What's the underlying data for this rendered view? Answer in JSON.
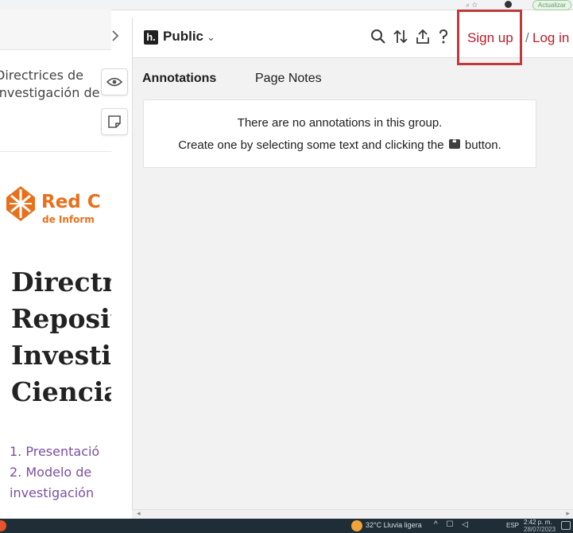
{
  "browser": {
    "update_label": "Actualizar"
  },
  "page": {
    "heading_lines": [
      "Directrices de",
      "Investigación de"
    ],
    "logo_text": "Red C",
    "logo_subtext": "de Inform",
    "title_lines": [
      "Directri",
      "Reposit",
      "Investig",
      "Ciencia"
    ],
    "toc": [
      "1. Presentació",
      "2. Modelo de",
      "investigación"
    ],
    "accent_color": "#7b4fa3",
    "logo_color": "#e8701a"
  },
  "sidebar": {
    "collapse_icon": "chevron-right-icon",
    "tab_annotations_icon": "eye-icon",
    "tab_notes_icon": "note-icon"
  },
  "hypothesis": {
    "logo_letter": "h.",
    "group": "Public",
    "group_chevron": "⌄",
    "signup": "Sign up",
    "slash": "/",
    "login": "Log in",
    "brand_color": "#bd1c2b",
    "tabs": [
      {
        "label": "Annotations",
        "active": true
      },
      {
        "label": "Page Notes",
        "active": false
      }
    ],
    "empty_line1": "There are no annotations in this group.",
    "empty_line2_before": "Create one by selecting some text and clicking the",
    "empty_line2_after": "button.",
    "quote_glyph": "❝"
  },
  "taskbar": {
    "weather": "32°C  Lluvia ligera",
    "tray": "^ ☐ ◁",
    "lang": "ESP",
    "time": "2:42 p. m.",
    "date": "28/07/2023"
  }
}
